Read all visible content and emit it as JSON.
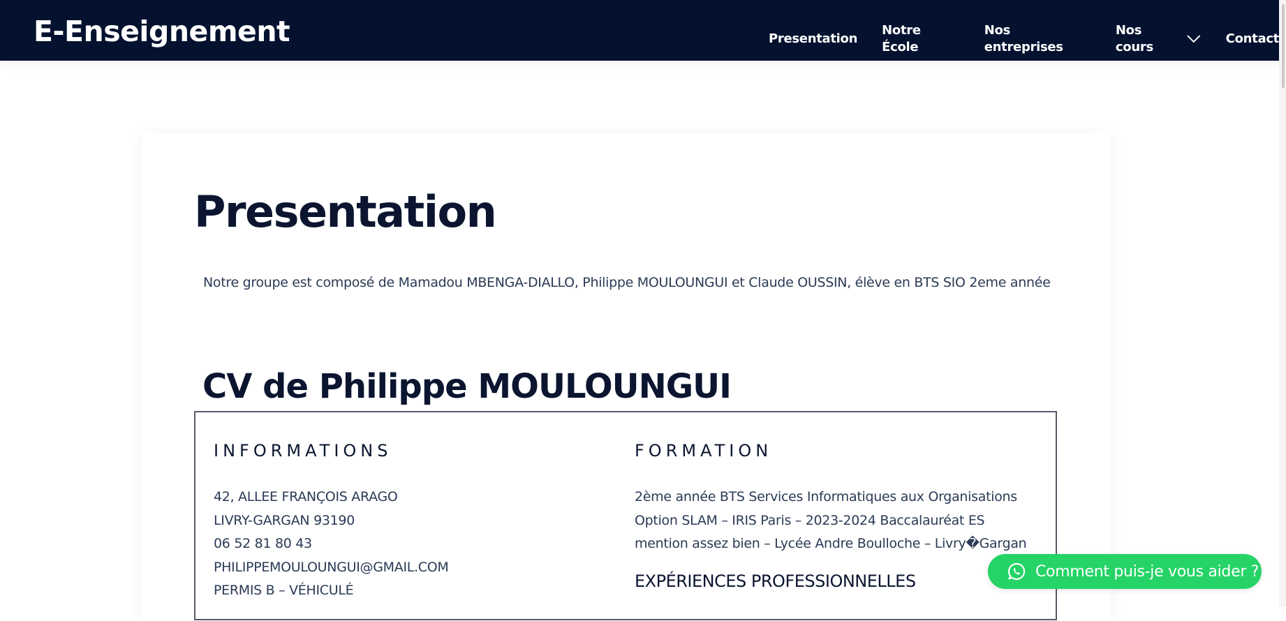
{
  "navbar": {
    "brand": "E-Enseignement",
    "links": [
      {
        "label": "Presentation"
      },
      {
        "label": "Notre École"
      },
      {
        "label": "Nos entreprises"
      },
      {
        "label": "Nos cours"
      },
      {
        "label": "Contact"
      }
    ]
  },
  "main": {
    "title": "Presentation",
    "intro": "Notre groupe est composé de Mamadou MBENGA-DIALLO, Philippe MOULOUNGUI et Claude OUSSIN, élève en BTS SIO 2eme année",
    "cv_title": "CV de Philippe MOULOUNGUI",
    "informations": {
      "heading": "INFORMATIONS",
      "lines": [
        "42, ALLEE FRANÇOIS ARAGO",
        "LIVRY-GARGAN 93190",
        "06 52 81 80 43",
        "PHILIPPEMOULOUNGUI@GMAIL.COM",
        "PERMIS B – VÉHICULÉ"
      ]
    },
    "formation": {
      "heading": "FORMATION",
      "text": "2ème année BTS Services Informatiques aux Organisations Option SLAM – IRIS Paris – 2023-2024 Baccalauréat ES mention assez bien – Lycée Andre Boulloche – Livry�Gargan",
      "experience_heading": "EXPÉRIENCES PROFESSIONNELLES"
    }
  },
  "chat_button": {
    "label": "Comment puis-je vous aider ?"
  },
  "colors": {
    "navbar_bg": "#04112f",
    "accent_green": "#25d366",
    "text_dark": "#0b1530",
    "text_body": "#2b3a55"
  },
  "icons": [
    "chevron-down-icon",
    "whatsapp-icon"
  ]
}
